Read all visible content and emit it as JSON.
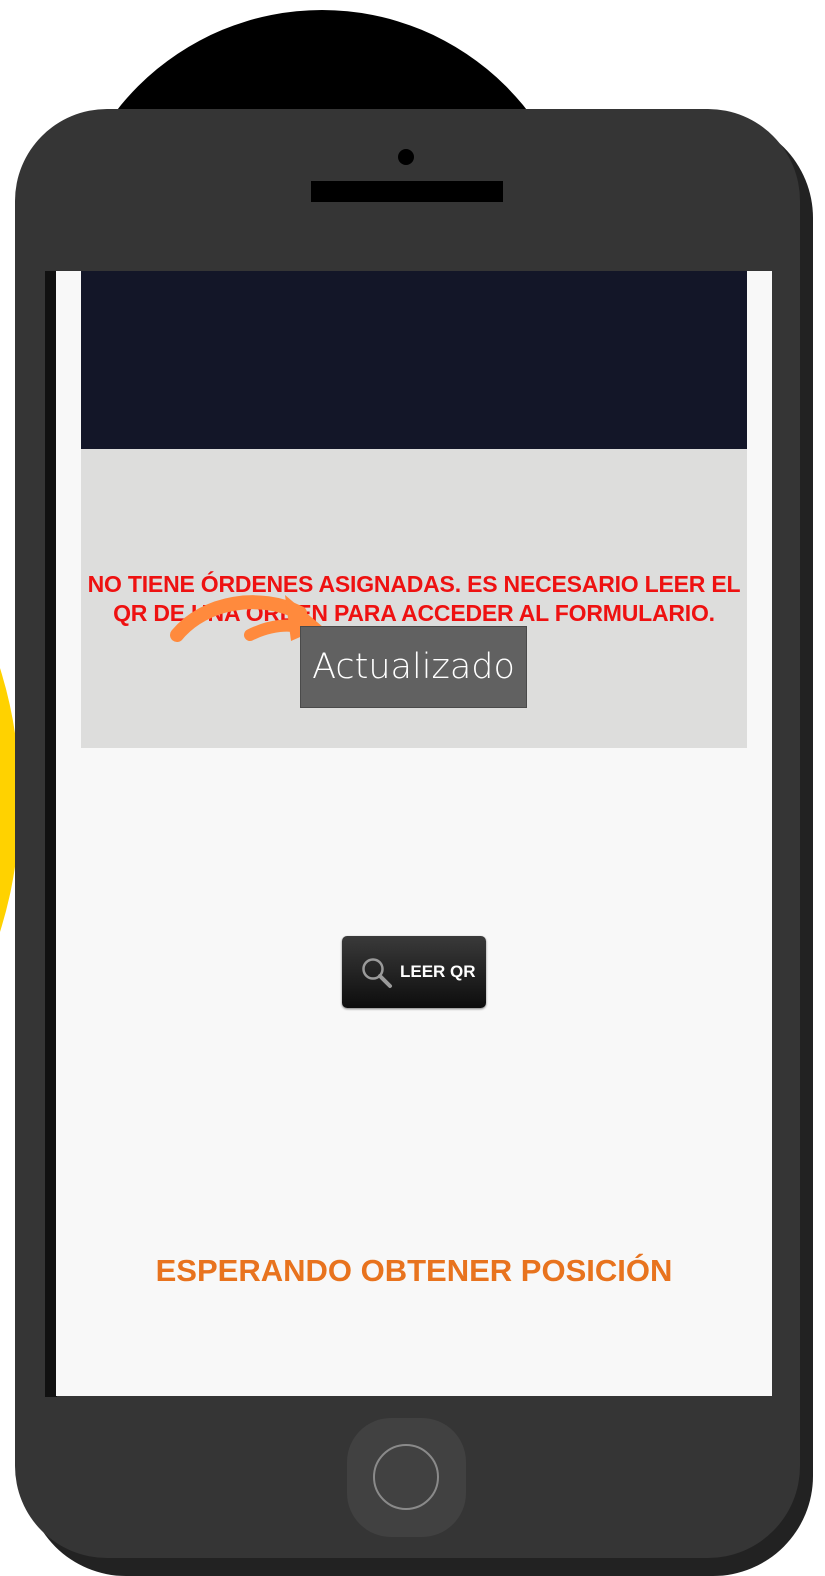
{
  "notice": {
    "line1": "NO TIENE ÓRDENES ASIGNADAS. ES NECESARIO LEER EL",
    "line2": "QR DE UNA ORDEN PARA ACCEDER AL FORMULARIO."
  },
  "toast": {
    "text": "Actualizado"
  },
  "qr_button": {
    "label": "LEER QR",
    "icon": "search-icon"
  },
  "status": {
    "text": "ESPERANDO OBTENER POSICIÓN"
  },
  "colors": {
    "header": "#131628",
    "notice": "#ee1111",
    "status": "#e8731e",
    "arrow": "#ff8a3d",
    "accent_background": "#ffd200"
  }
}
